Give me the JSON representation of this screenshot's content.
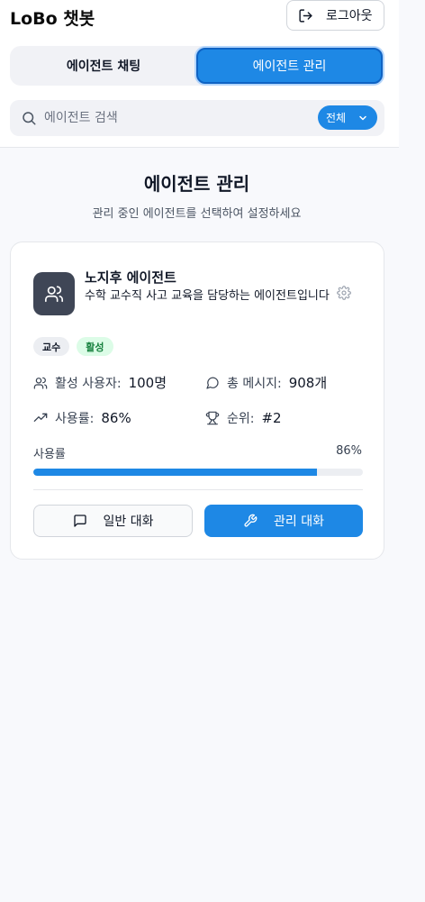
{
  "header": {
    "app_title": "LoBo 챗봇",
    "logout_label": "로그아웃"
  },
  "tabs": [
    {
      "label": "에이전트 채팅",
      "active": false
    },
    {
      "label": "에이전트 관리",
      "active": true
    }
  ],
  "search": {
    "placeholder": "에이전트 검색",
    "value": "",
    "filter_selected": "전체"
  },
  "page": {
    "title": "에이전트 관리",
    "subtitle": "관리 중인 에이전트를 선택하여 설정하세요"
  },
  "agents": [
    {
      "name": "노지후 에이전트",
      "description": "수학 교수직 사고 교육을 담당하는 에이전트입니다",
      "avatar_icon": "users-icon",
      "tags": {
        "role": "교수",
        "status": "활성"
      },
      "stats": {
        "active_users_label": "활성 사용자:",
        "active_users_value": "100명",
        "messages_label": "총 메시지:",
        "messages_value": "908개",
        "usage_label": "사용률:",
        "usage_value": "86%",
        "rank_label": "순위:",
        "rank_value": "#2"
      },
      "usage_bar_label": "사용률",
      "usage_bar_value": "86%",
      "usage_fraction": 0.86,
      "general_chat_label": "일반 대화",
      "admin_chat_label": "관리 대화"
    }
  ],
  "colors": {
    "accent": "#1e88e5",
    "avatar_bg": "#3f4656",
    "status_bg": "#dcfce7",
    "status_text": "#15803d"
  }
}
